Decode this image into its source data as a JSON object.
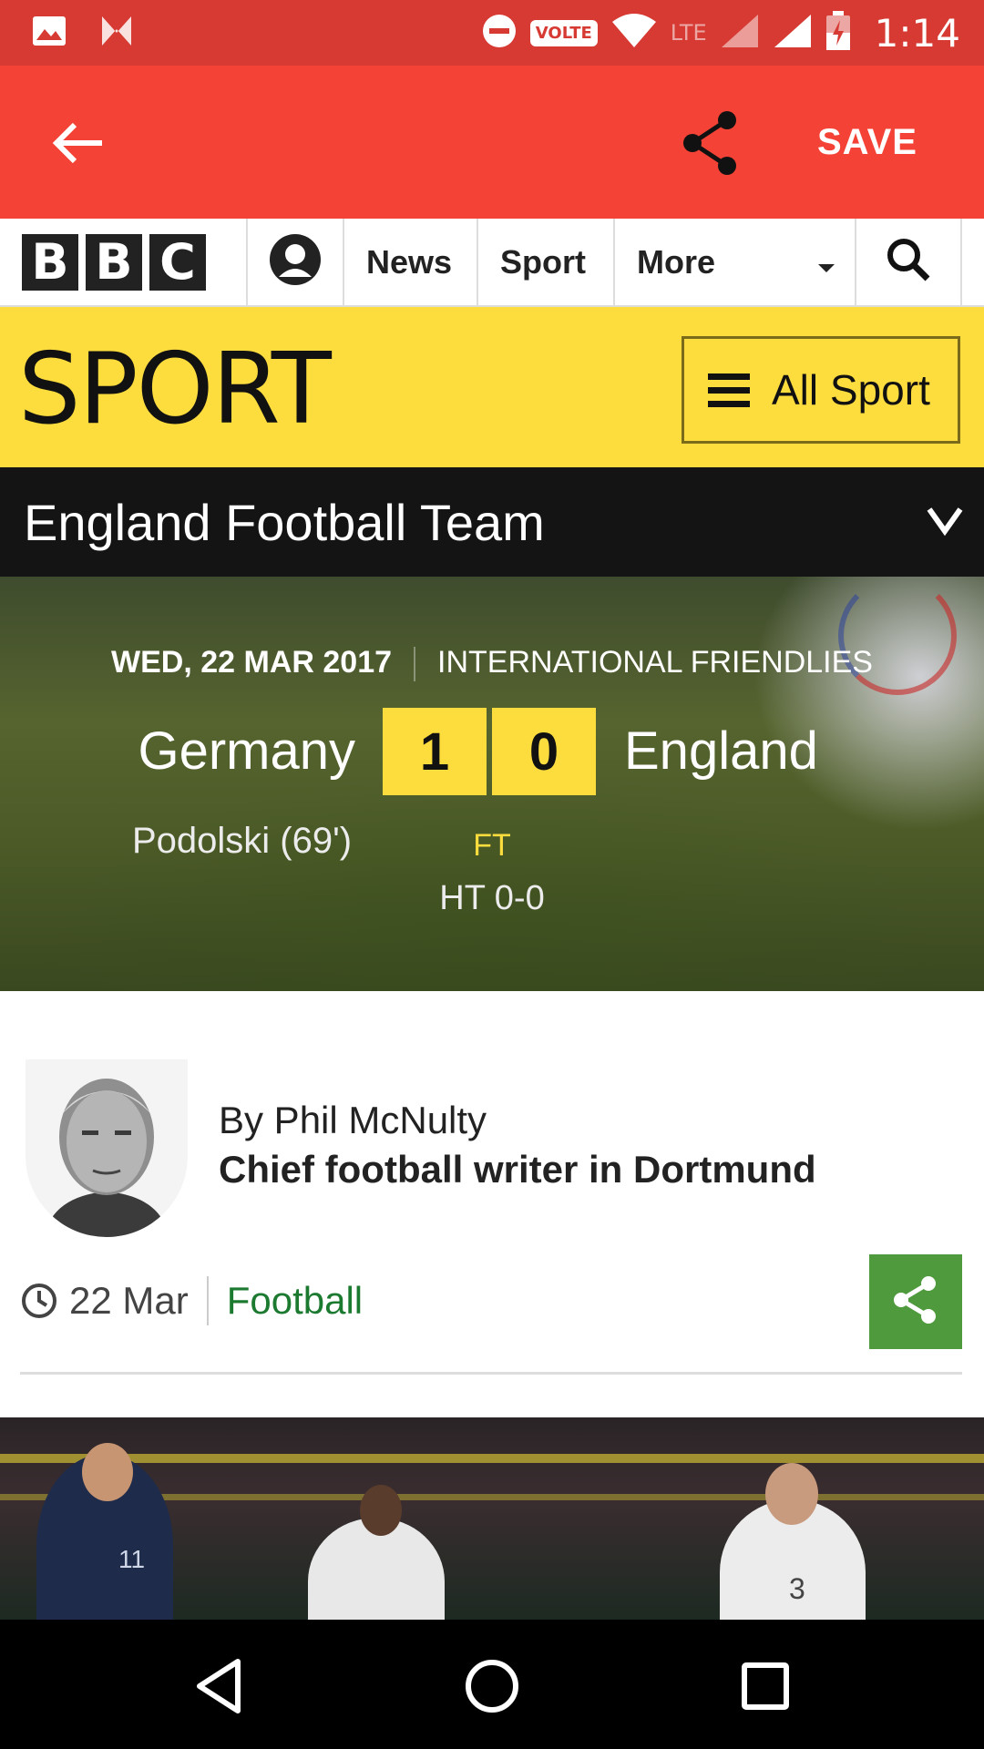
{
  "status_bar": {
    "time": "1:14",
    "network": "VOLTE",
    "lte": "LTE",
    "icons": [
      "image-icon",
      "n-icon",
      "dnd-icon",
      "wifi-icon",
      "signal-icon",
      "battery-charging-icon"
    ]
  },
  "app_bar": {
    "save_label": "SAVE",
    "icons": [
      "back-arrow-icon",
      "share-icon"
    ]
  },
  "bbc_nav": {
    "logo_letters": [
      "B",
      "B",
      "C"
    ],
    "items": [
      {
        "label": "News"
      },
      {
        "label": "Sport"
      },
      {
        "label": "More"
      }
    ]
  },
  "sport_banner": {
    "title": "SPORT",
    "all_sport_label": "All Sport"
  },
  "team_bar": {
    "title": "England Football Team"
  },
  "match": {
    "date": "WED, 22 MAR 2017",
    "competition": "INTERNATIONAL FRIENDLIES",
    "home_team": "Germany",
    "away_team": "England",
    "home_score": "1",
    "away_score": "0",
    "scorer": "Podolski (69')",
    "status": "FT",
    "half_time": "HT 0-0"
  },
  "byline": {
    "author": "By Phil McNulty",
    "role": "Chief football writer in Dortmund",
    "date": "22 Mar",
    "topic": "Football"
  },
  "article_image": {
    "kit_numbers": [
      "11",
      "3"
    ]
  },
  "colors": {
    "status_bar": "#d63a33",
    "app_bar": "#f44336",
    "sport_yellow": "#fddc3e",
    "team_bar": "#141414",
    "link_green": "#1b7a2f",
    "share_green": "#4e9a3c"
  }
}
